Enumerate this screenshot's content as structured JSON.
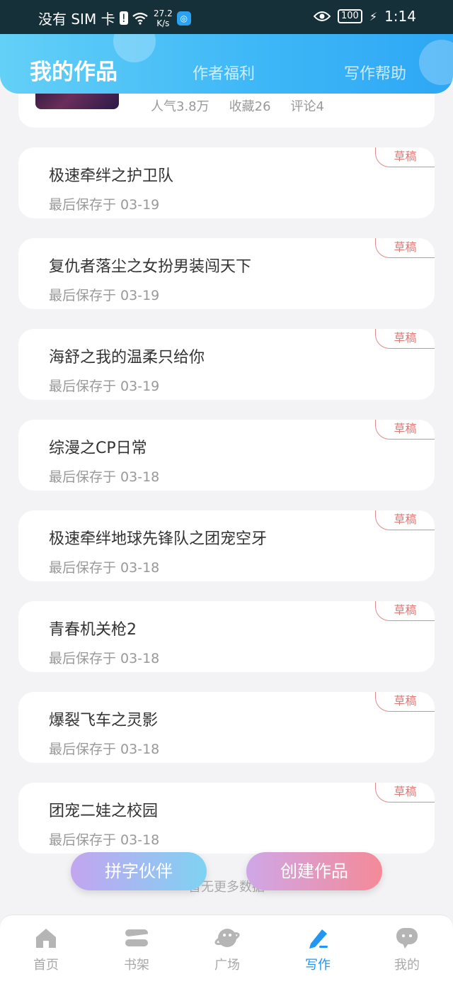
{
  "status_bar": {
    "carrier": "没有 SIM 卡",
    "speed_top": "27.2",
    "speed_bottom": "K/s",
    "battery": "100",
    "time": "1:14"
  },
  "header": {
    "tabs": [
      {
        "label": "我的作品"
      },
      {
        "label": "作者福利"
      },
      {
        "label": "写作帮助"
      }
    ]
  },
  "first_work": {
    "stats": {
      "popularity": "人气3.8万",
      "favorites": "收藏26",
      "comments": "评论4"
    }
  },
  "draft_tag": "草稿",
  "works": [
    {
      "title": "极速牵绊之护卫队",
      "saved": "最后保存于 03-19"
    },
    {
      "title": "复仇者落尘之女扮男装闯天下",
      "saved": "最后保存于 03-19"
    },
    {
      "title": "海舒之我的温柔只给你",
      "saved": "最后保存于 03-19"
    },
    {
      "title": "综漫之CP日常",
      "saved": "最后保存于 03-18"
    },
    {
      "title": "极速牵绊地球先锋队之团宠空牙",
      "saved": "最后保存于 03-18"
    },
    {
      "title": "青春机关枪2",
      "saved": "最后保存于 03-18"
    },
    {
      "title": "爆裂飞车之灵影",
      "saved": "最后保存于 03-18"
    },
    {
      "title": "团宠二娃之校园",
      "saved": "最后保存于 03-18"
    }
  ],
  "no_more": "暂无更多数据",
  "buttons": {
    "partner": "拼字伙伴",
    "create": "创建作品"
  },
  "nav": [
    {
      "label": "首页",
      "icon": "home-icon"
    },
    {
      "label": "书架",
      "icon": "bookshelf-icon"
    },
    {
      "label": "广场",
      "icon": "planet-icon"
    },
    {
      "label": "写作",
      "icon": "pen-icon"
    },
    {
      "label": "我的",
      "icon": "chat-face-icon"
    }
  ],
  "colors": {
    "accent": "#2196f3",
    "draft": "#e07a77"
  }
}
